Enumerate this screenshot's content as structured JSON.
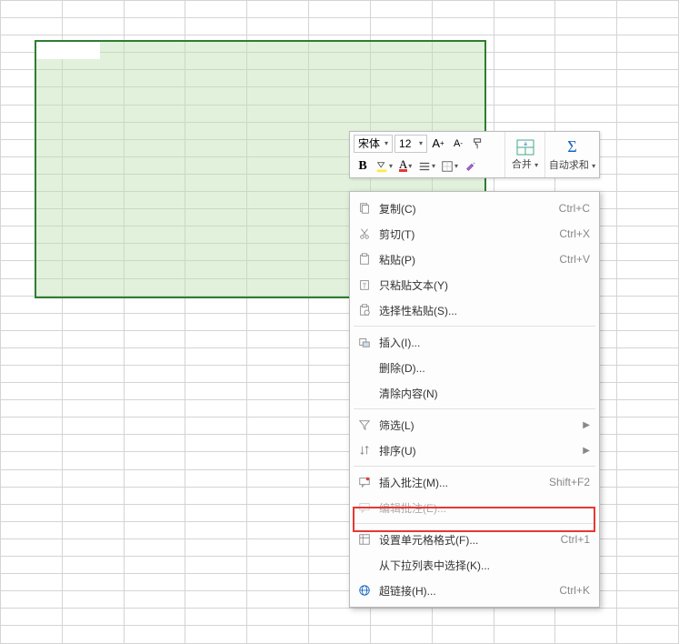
{
  "minitoolbar": {
    "font_name": "宋体",
    "font_size": "12",
    "increase_font_tip": "A+",
    "decrease_font_tip": "A-",
    "merge_label": "合并",
    "autosum_label": "自动求和",
    "bold_label": "B",
    "font_color_label": "A"
  },
  "contextmenu": {
    "copy": {
      "label": "复制(C)",
      "shortcut": "Ctrl+C"
    },
    "cut": {
      "label": "剪切(T)",
      "shortcut": "Ctrl+X"
    },
    "paste": {
      "label": "粘贴(P)",
      "shortcut": "Ctrl+V"
    },
    "paste_text": {
      "label": "只粘贴文本(Y)",
      "shortcut": ""
    },
    "paste_special": {
      "label": "选择性粘贴(S)...",
      "shortcut": ""
    },
    "insert": {
      "label": "插入(I)...",
      "shortcut": ""
    },
    "delete": {
      "label": "删除(D)...",
      "shortcut": ""
    },
    "clear": {
      "label": "清除内容(N)",
      "shortcut": ""
    },
    "filter": {
      "label": "筛选(L)",
      "shortcut": ""
    },
    "sort": {
      "label": "排序(U)",
      "shortcut": ""
    },
    "insert_comment": {
      "label": "插入批注(M)...",
      "shortcut": "Shift+F2"
    },
    "edit_comment": {
      "label": "编辑批注(E)...",
      "shortcut": ""
    },
    "format_cells": {
      "label": "设置单元格格式(F)...",
      "shortcut": "Ctrl+1"
    },
    "pick_list": {
      "label": "从下拉列表中选择(K)...",
      "shortcut": ""
    },
    "hyperlink": {
      "label": "超链接(H)...",
      "shortcut": "Ctrl+K"
    }
  }
}
